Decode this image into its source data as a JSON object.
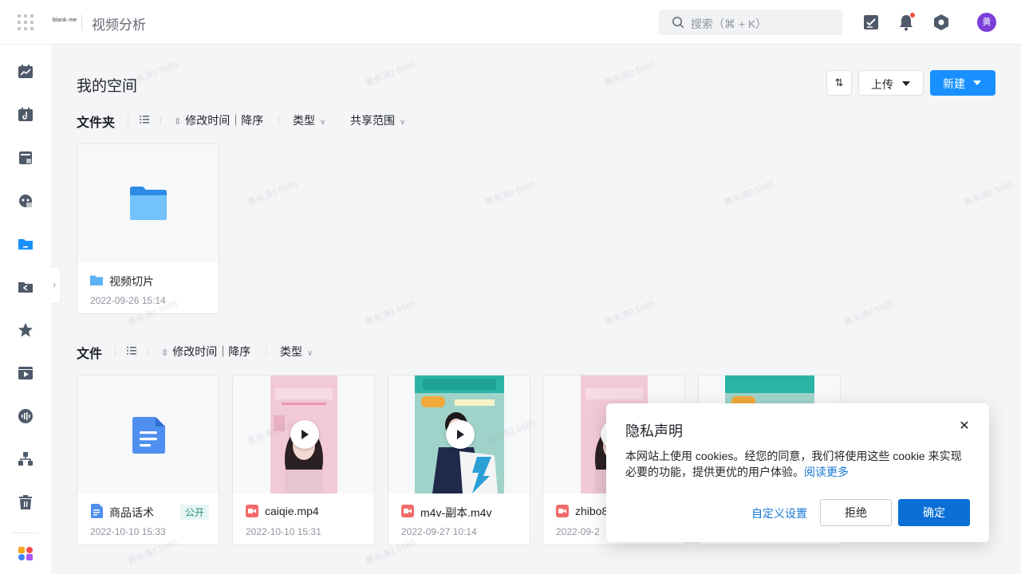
{
  "header": {
    "brand_logo_text": "blank·me",
    "app_title": "视频分析",
    "search_placeholder": "搜索（⌘ + K）",
    "avatar_text": "黄"
  },
  "sidebar": {
    "icons": [
      "chart-icon",
      "tiktok-icon",
      "store-icon",
      "robot-icon",
      "folder-icon",
      "share-folder-icon",
      "star-icon",
      "video-icon",
      "audio-icon",
      "org-icon",
      "trash-icon",
      "apps-icon"
    ],
    "active_index": 4
  },
  "main": {
    "title": "我的空间",
    "upload_label": "上传",
    "new_label": "新建",
    "sort_toggle_label": "⇅"
  },
  "folders_section": {
    "label": "文件夹",
    "sort_text": "修改时间｜降序",
    "filters": [
      "类型",
      "共享范围"
    ],
    "items": [
      {
        "name": "视频切片",
        "date": "2022-09-26 15:14"
      }
    ]
  },
  "files_section": {
    "label": "文件",
    "sort_text": "修改时间｜降序",
    "filters": [
      "类型"
    ],
    "items": [
      {
        "name": "商品话术",
        "date": "2022-10-10 15:33",
        "type": "doc",
        "badge": "公开"
      },
      {
        "name": "caiqie.mp4",
        "date": "2022-10-10 15:31",
        "type": "video"
      },
      {
        "name": "m4v-副本.m4v",
        "date": "2022-09-27 10:14",
        "type": "video"
      },
      {
        "name": "zhibo8",
        "date": "2022-09-2",
        "type": "video"
      }
    ]
  },
  "privacy_dialog": {
    "title": "隐私声明",
    "body": "本网站上使用 cookies。经您的同意，我们将使用这些 cookie 来实现必要的功能，提供更优的用户体验。",
    "read_more": "阅读更多",
    "custom_label": "自定义设置",
    "reject_label": "拒绝",
    "confirm_label": "确定"
  },
  "watermark": "黄永涛2 5685",
  "colors": {
    "primary": "#1890ff",
    "confirm": "#0a6fd6",
    "link": "#1677d4",
    "avatar": "#7b3fd8",
    "folder": "#5cb2f5"
  }
}
